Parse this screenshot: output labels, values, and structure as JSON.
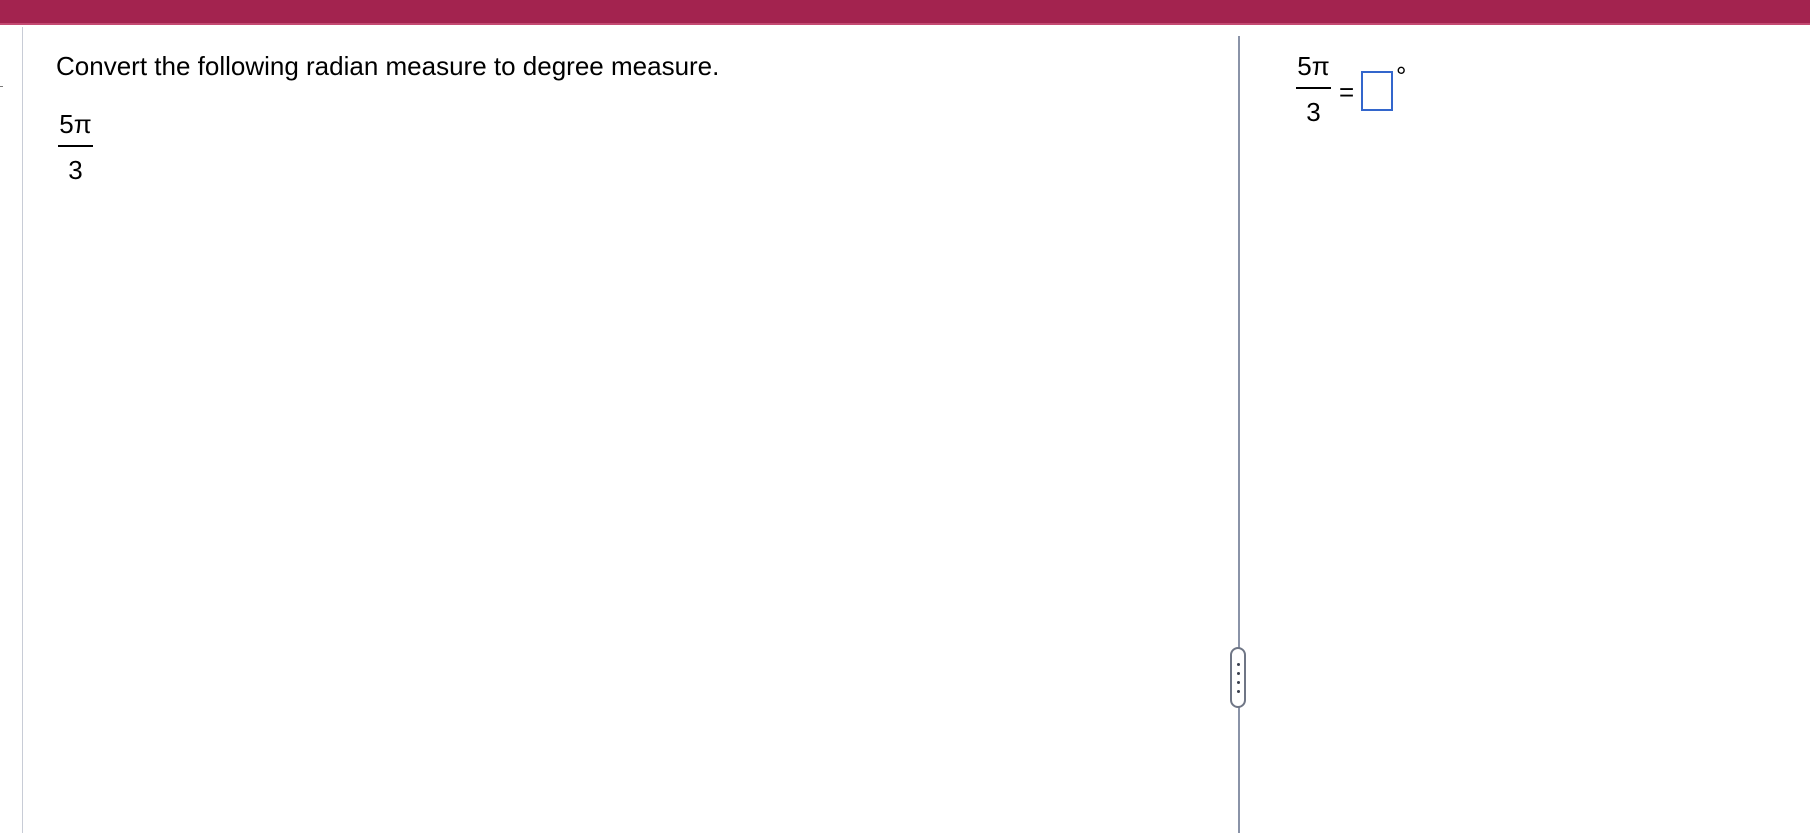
{
  "question": {
    "instruction": "Convert the following radian measure to degree measure.",
    "expression": {
      "numerator": "5π",
      "denominator": "3"
    }
  },
  "answer": {
    "numerator": "5π",
    "denominator": "3",
    "equals": "=",
    "input_value": "",
    "unit": "°"
  },
  "colors": {
    "header_bar": "#a3234f",
    "answer_box_border": "#3366cc",
    "divider": "#8a93a8"
  },
  "icons": {
    "splitter_handle": "vertical-dots-icon"
  }
}
